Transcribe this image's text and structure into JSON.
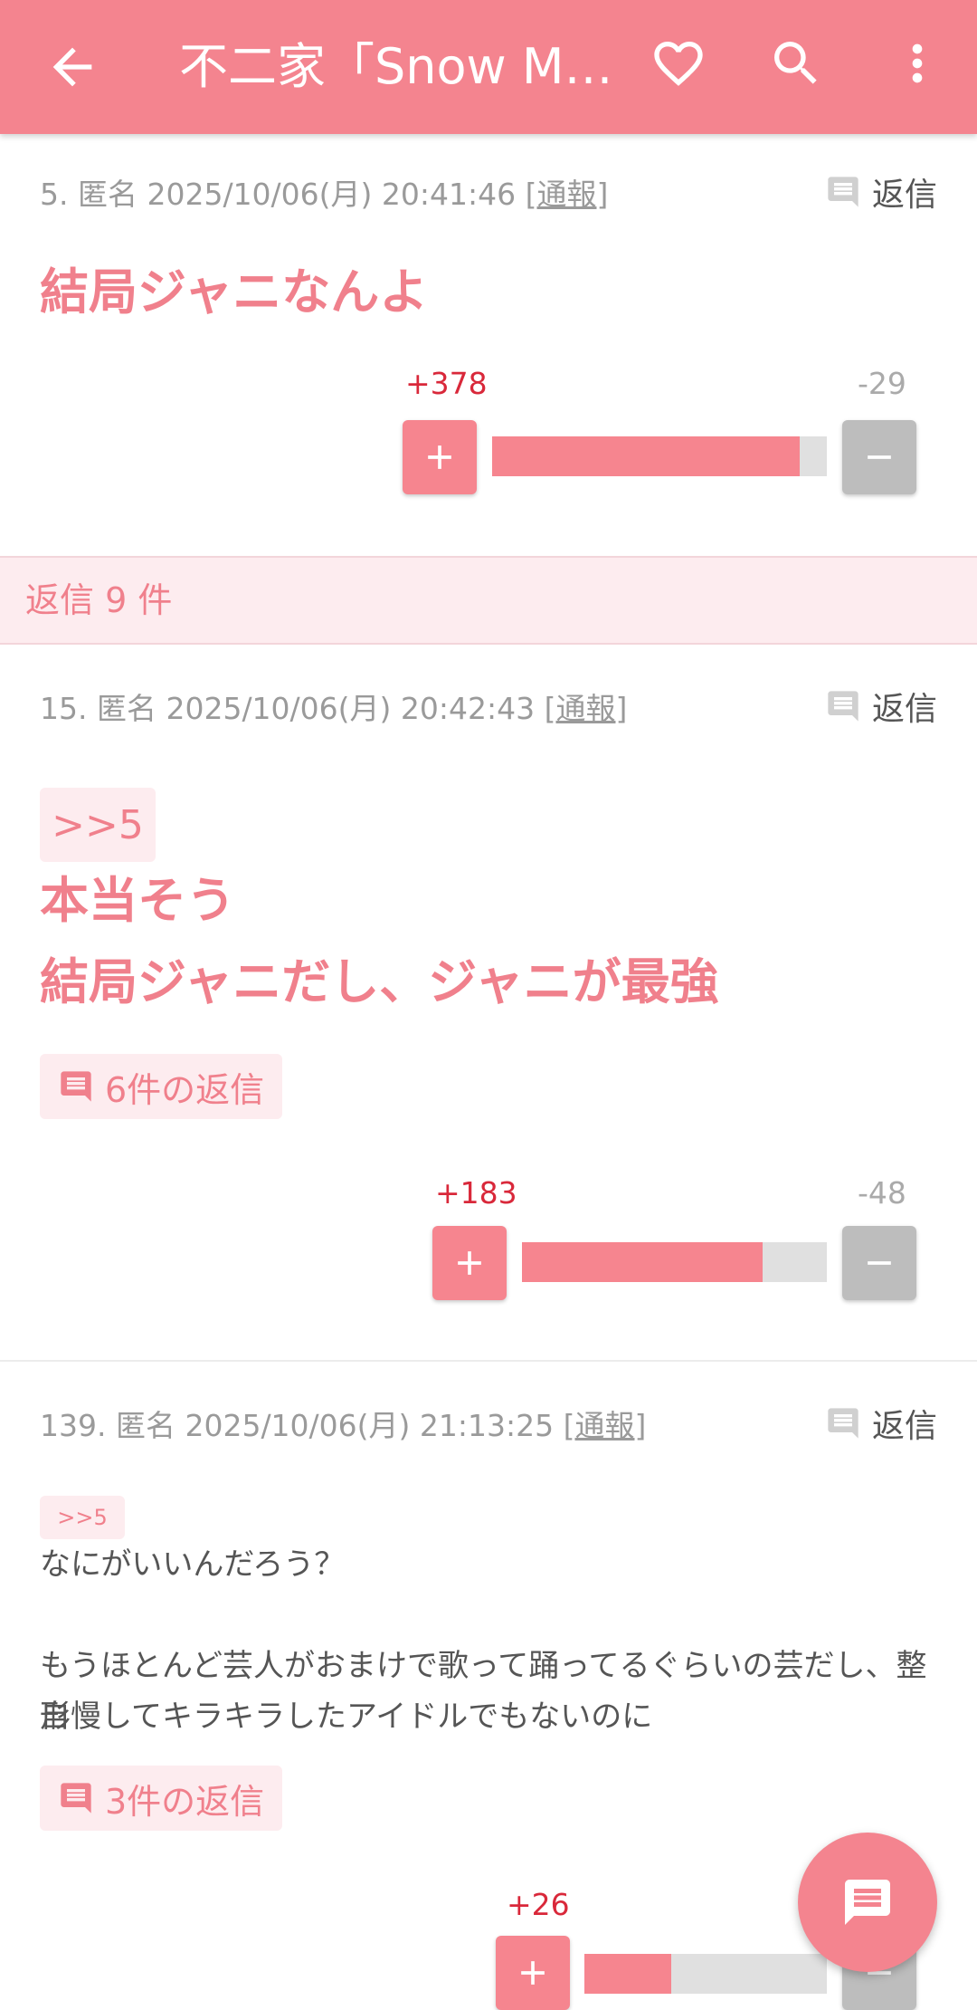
{
  "appbar": {
    "title": "不二家「Snow Ma..."
  },
  "posts": [
    {
      "meta_prefix": "5. 匿名 2025/10/06(月) 20:41:46 [",
      "report": "通報",
      "meta_suffix": "]",
      "reply_label": "返信",
      "lines": [
        "結局ジャニなんよ"
      ],
      "plus": "+378",
      "minus": "-29",
      "plus_ratio": 0.92
    },
    {
      "meta_prefix": "15. 匿名 2025/10/06(月) 20:42:43 [",
      "report": "通報",
      "meta_suffix": "]",
      "reply_label": "返信",
      "quote": ">>5",
      "lines": [
        "本当そう",
        "結局ジャニだし、ジャニが最強"
      ],
      "replies": "6件の返信",
      "plus": "+183",
      "minus": "-48",
      "plus_ratio": 0.79
    },
    {
      "meta_prefix": "139. 匿名 2025/10/06(月) 21:13:25 [",
      "report": "通報",
      "meta_suffix": "]",
      "reply_label": "返信",
      "quote": ">>5",
      "lines": [
        "なにがいいんだろう？",
        "",
        "もうほとんど芸人がおまけで歌って踊ってるぐらいの芸だし、整形",
        "自慢してキラキラしたアイドルでもないのに"
      ],
      "replies": "3件の返信",
      "plus": "+26",
      "plus_ratio": 0.36
    }
  ],
  "section": {
    "label": "返信 9 件"
  },
  "colors": {
    "accent": "#f4848f",
    "plus_count": "#d9283a",
    "chip_bg": "#fdecef"
  },
  "icons": [
    "arrow-back-icon",
    "heart-outline-icon",
    "search-icon",
    "more-vert-icon",
    "comment-icon",
    "plus-icon",
    "minus-icon",
    "chat-icon"
  ]
}
